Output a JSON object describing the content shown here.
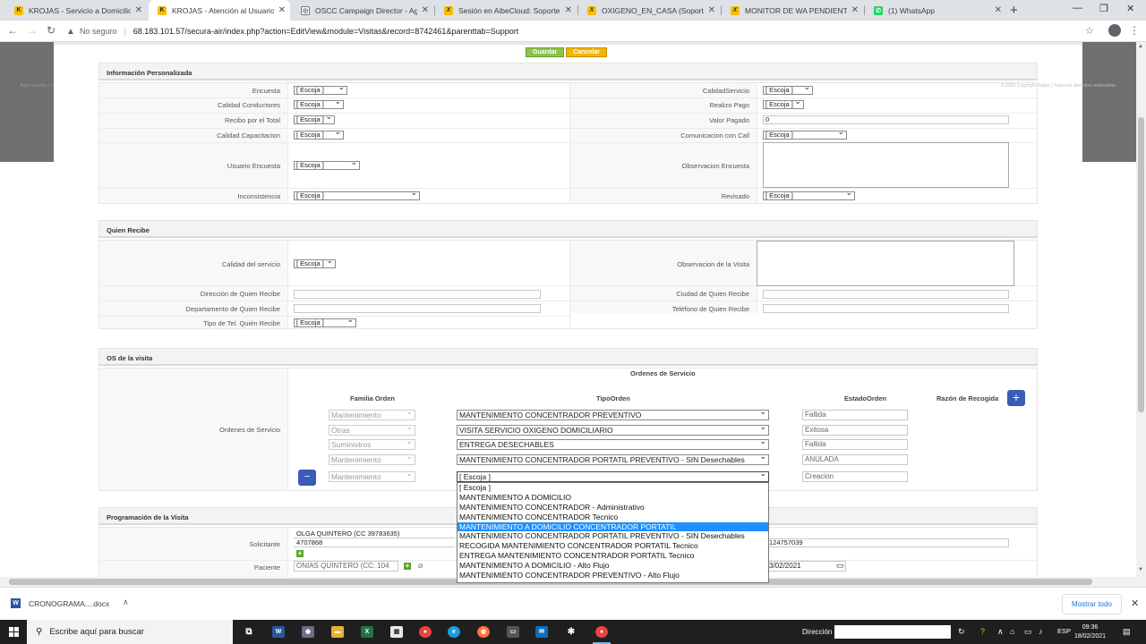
{
  "browser": {
    "tabs": [
      {
        "title": "KROJAS - Servicio a Domicilio - ",
        "favicon": "krojas-icon",
        "active": false
      },
      {
        "title": "KROJAS - Atención al Usuario - ",
        "favicon": "krojas-icon",
        "active": true
      },
      {
        "title": "OSCC Campaign Director - Agen",
        "favicon": "globe-icon",
        "active": false
      },
      {
        "title": "Sesión en AibeCloud: Soporte di",
        "favicon": "aibe-icon",
        "active": false
      },
      {
        "title": "OXIGENO_EN_CASA (Soporte di",
        "favicon": "aibe-icon",
        "active": false
      },
      {
        "title": "MONITOR DE WA PENDIENTES",
        "favicon": "aibe-icon",
        "active": false
      },
      {
        "title": "(1) WhatsApp",
        "favicon": "whatsapp-icon",
        "active": false
      }
    ],
    "address": {
      "security": "No seguro",
      "url": "68.183.101.57/secura-air/index.php?action=EditView&module=Visitas&record=8742461&parenttab=Support"
    },
    "overlay": {
      "left_text": "Agen Gaorda 2.4",
      "right_text": "© 2020 Copyright Krojas  |  Todos los derechos reservados"
    }
  },
  "form": {
    "save_label": "Guardar",
    "cancel_label": "Cancelar",
    "info": {
      "title": "Información Personalizada",
      "encuesta_label": "Encuesta",
      "encuesta_value": "[ Escoja ]",
      "calidad_servicio_label": "CalidadServicio",
      "calidad_servicio_value": "[ Escoja ]",
      "calidad_conductores_label": "Calidad Conductores",
      "calidad_conductores_value": "[ Escoja ]",
      "realizo_pago_label": "Realizo Pago",
      "realizo_pago_value": "[ Escoja ]",
      "recibo_total_label": "Recibo por el Total",
      "recibo_total_value": "[ Escoja ]",
      "valor_pagado_label": "Valor Pagado",
      "valor_pagado_value": "0",
      "calidad_capacitacion_label": "Calidad Capacitacion",
      "calidad_capacitacion_value": "[ Escoja ]",
      "comunicacion_call_label": "Comunicacion con Call",
      "comunicacion_call_value": "[ Escoja ]",
      "usuario_encuesta_label": "Usuario Encuesta",
      "usuario_encuesta_value": "[ Escoja ]",
      "observacion_encuesta_label": "Observacion Encuesta",
      "inconsistencia_label": "Inconsistencia",
      "inconsistencia_value": "[ Escoja ]",
      "revisado_label": "Revisado",
      "revisado_value": "[ Escoja ]"
    },
    "recibe": {
      "title": "Quien Recibe",
      "calidad_servicio_label": "Calidad del servicio",
      "calidad_servicio_value": "[ Escoja ]",
      "observacion_visita_label": "Observacion de la Visita",
      "direccion_label": "Dirección de Quien Recibe",
      "ciudad_label": "Ciudad de Quien Recibe",
      "departamento_label": "Departamento de Quien Recibe",
      "telefono_label": "Teléfono de Quien Recibe",
      "tipo_tel_label": "Tipo de Tel. Quién Recibe",
      "tipo_tel_value": "[ Escoja ]"
    },
    "os": {
      "title": "OS de la visita",
      "ordenes_label": "Ordenes de Servicio",
      "table_title": "Ordenes de Servicio",
      "col_familia": "Familia Orden",
      "col_tipo": "TipoOrden",
      "col_estado": "EstadoOrden",
      "col_razon": "Razón de Recogida",
      "rows": [
        {
          "familia": "Mantenimiento",
          "tipo": "MANTENIMIENTO CONCENTRADOR PREVENTIVO",
          "estado": "Fallida"
        },
        {
          "familia": "Otras",
          "tipo": "VISITA SERVICIO OXIGENO DOMICILIARIO",
          "estado": "Exitosa"
        },
        {
          "familia": "Suministros",
          "tipo": "ENTREGA DESECHABLES",
          "estado": "Fallida"
        },
        {
          "familia": "Mantenimiento",
          "tipo": "MANTENIMIENTO CONCENTRADOR PORTATIL PREVENTIVO - SIN Desechables",
          "estado": "ANULADA"
        },
        {
          "familia": "Mantenimiento",
          "tipo": "[ Escoja ]",
          "estado": "Creacion"
        }
      ],
      "dropdown_options": [
        "[ Escoja ]",
        "MANTENIMIENTO A DOMICILIO",
        "MANTENIMIENTO CONCENTRADOR - Administrativo",
        "MANTENIMIENTO CONCENTRADOR Tecnico",
        "MANTENIMIENTO A DOMICILIO CONCENTRADOR PORTATIL",
        "MANTENIMIENTO CONCENTRADOR PORTATIL PREVENTIVO - SIN Desechables",
        "RECOGIDA MANTENIMIENTO CONCENTRADOR PORTATIL Tecnico",
        "ENTREGA MANTENIMIENTO CONCENTRADOR PORTATIL Tecnico",
        "MANTENIMIENTO A DOMICILIO - Alto Flujo",
        "MANTENIMIENTO CONCENTRADOR PREVENTIVO - Alto Flujo"
      ],
      "highlighted_option": "MANTENIMIENTO A DOMICILIO CONCENTRADOR PORTATIL"
    },
    "programacion": {
      "title": "Programación de la Visita",
      "solicitante_label": "Solicitante",
      "solicitante_value": "OLGA QUINTERO (CC 39783635)",
      "solicitante_phone": "4707868",
      "right_phone": "124757039",
      "paciente_label": "Paciente",
      "paciente_value": "ONIAS QUINTERO (CC: 104",
      "fecha_value": "3/02/2021"
    }
  },
  "downloads": {
    "file_name": "CRONOGRAMA....docx",
    "show_all": "Mostrar todo"
  },
  "taskbar": {
    "search_placeholder": "Escribe aquí para buscar",
    "address_label": "Dirección",
    "language": "ESP",
    "time": "09:36",
    "date": "18/02/2021"
  }
}
